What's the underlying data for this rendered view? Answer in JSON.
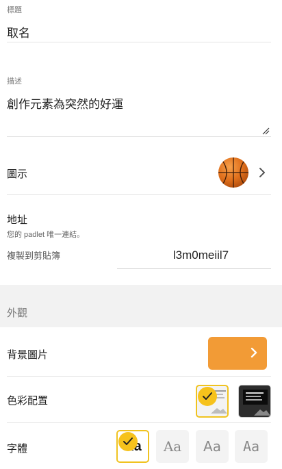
{
  "title_field": {
    "label": "標題",
    "value": "取名"
  },
  "description_field": {
    "label": "描述",
    "value": "創作元素為突然的好運"
  },
  "icon_row": {
    "label": "圖示",
    "icon": "basketball-emoji"
  },
  "address": {
    "title": "地址",
    "subtitle": "您的 padlet 唯一連結。",
    "copy_label": "複製到剪貼簿",
    "slug": "l3m0meiil7"
  },
  "appearance": {
    "section_title": "外觀",
    "background_label": "背景圖片",
    "background_color": "#f29b36",
    "color_scheme_label": "色彩配置",
    "color_schemes": [
      {
        "name": "light",
        "selected": true
      },
      {
        "name": "dark",
        "selected": false
      }
    ],
    "font_label": "字體",
    "fonts": [
      {
        "sample": "Aa",
        "selected": true
      },
      {
        "sample": "Aa",
        "selected": false
      },
      {
        "sample": "Aa",
        "selected": false
      },
      {
        "sample": "Aa",
        "selected": false
      }
    ],
    "accent_color": "#f6c21c"
  }
}
